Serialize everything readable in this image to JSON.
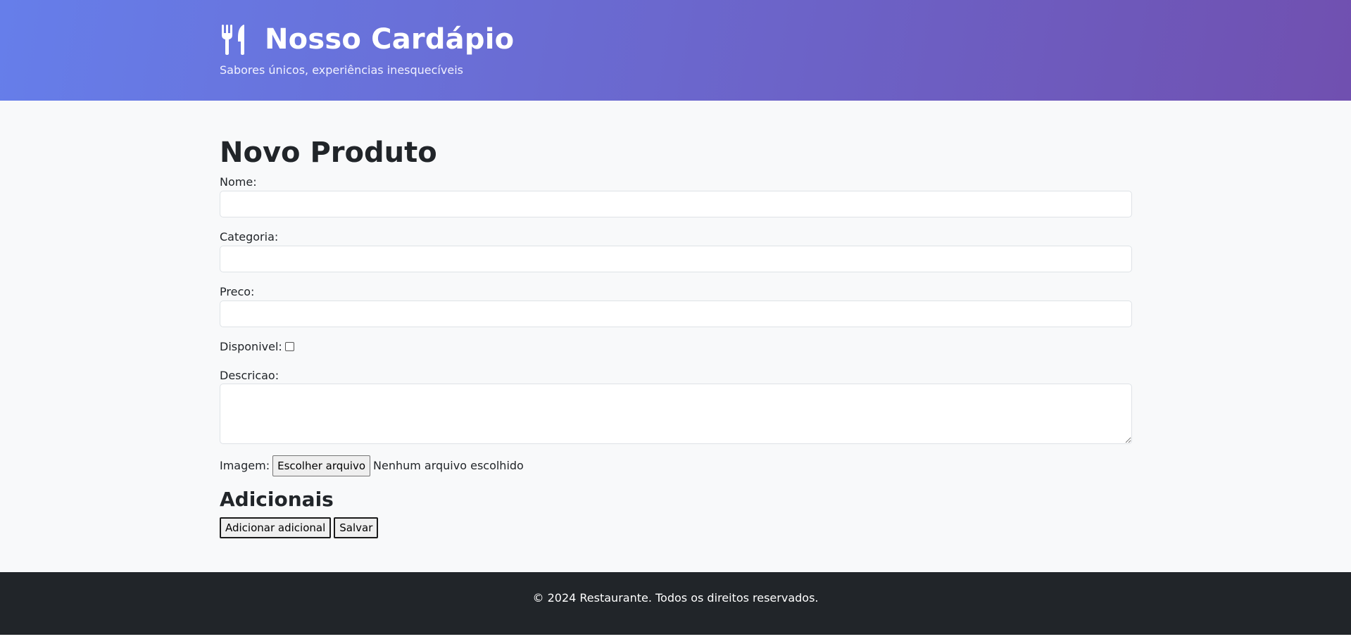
{
  "header": {
    "icon": "utensils-icon",
    "title": "Nosso Cardápio",
    "subtitle": "Sabores únicos, experiências inesquecíveis",
    "gradient_start": "#667eea",
    "gradient_end": "#7050b0"
  },
  "form": {
    "title": "Novo Produto",
    "nome_label": "Nome:",
    "nome_value": "",
    "categoria_label": "Categoria:",
    "categoria_value": "",
    "preco_label": "Preco:",
    "preco_value": "",
    "disponivel_label": "Disponivel:",
    "disponivel_checked": false,
    "descricao_label": "Descricao:",
    "descricao_value": "",
    "imagem_label": "Imagem:",
    "file_button_label": "Escolher arquivo",
    "file_status": "Nenhum arquivo escolhido",
    "adicionais_title": "Adicionais",
    "add_adicional_label": "Adicionar adicional",
    "salvar_label": "Salvar"
  },
  "footer": {
    "text": "© 2024 Restaurante. Todos os direitos reservados.",
    "background": "#212529"
  }
}
